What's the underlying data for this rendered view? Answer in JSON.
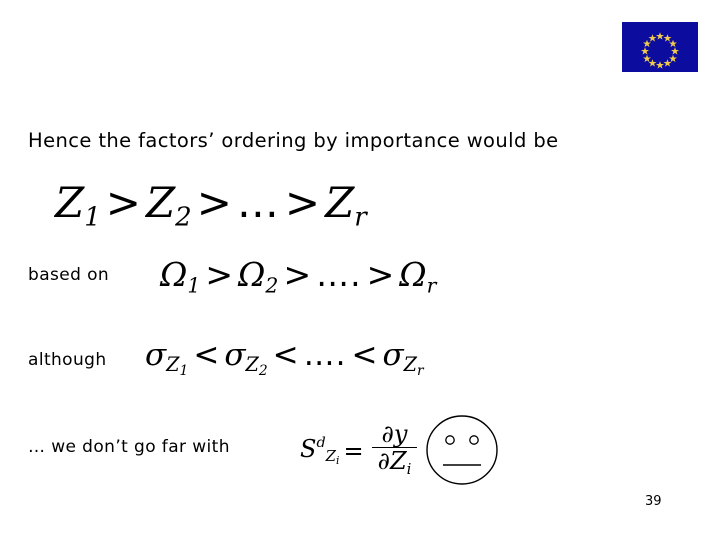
{
  "slide": {
    "background_color": "#ffffff",
    "text_color": "#000000",
    "number": "39"
  },
  "logo": {
    "name": "european-union-flag",
    "flag_blue": "#0c0c9e",
    "star_yellow": "#ffcc00",
    "star_count": 12
  },
  "headline": "Hence the factors’ ordering by importance would be",
  "labels": {
    "based_on": "based on",
    "although": "although",
    "far_with": "… we don’t go far with"
  },
  "equations": {
    "z_order": {
      "terms": [
        "Z",
        "1",
        "Z",
        "2",
        "Z",
        "r"
      ],
      "operator": ">",
      "ellipsis": "…",
      "plain": "Z1 > Z2 > … > Zr"
    },
    "omega_order": {
      "symbol": "Ω",
      "operator": ">",
      "ellipsis": "….",
      "subscripts": [
        "1",
        "2",
        "r"
      ],
      "plain": "Ω1 > Ω2 > …. > Ωr"
    },
    "sigma_order": {
      "symbol": "σ",
      "base": "Z",
      "operator": "<",
      "ellipsis": "….",
      "subscripts": [
        "1",
        "2",
        "r"
      ],
      "plain": "σZ1 < σZ2 < …. < σZr"
    },
    "derivative": {
      "lhs_base": "S",
      "lhs_sup": "d",
      "lhs_sub_base": "Z",
      "lhs_sub_sub": "i",
      "equals": "=",
      "numerator_partial": "∂",
      "numerator_var": "y",
      "denominator_partial": "∂",
      "denominator_var": "Z",
      "denominator_sub": "i",
      "plain": "S^d_{Zi} = ∂y / ∂Zi"
    }
  },
  "face": {
    "name": "neutral-face-doodle",
    "expression": "neutral",
    "stroke_color": "#000000"
  }
}
